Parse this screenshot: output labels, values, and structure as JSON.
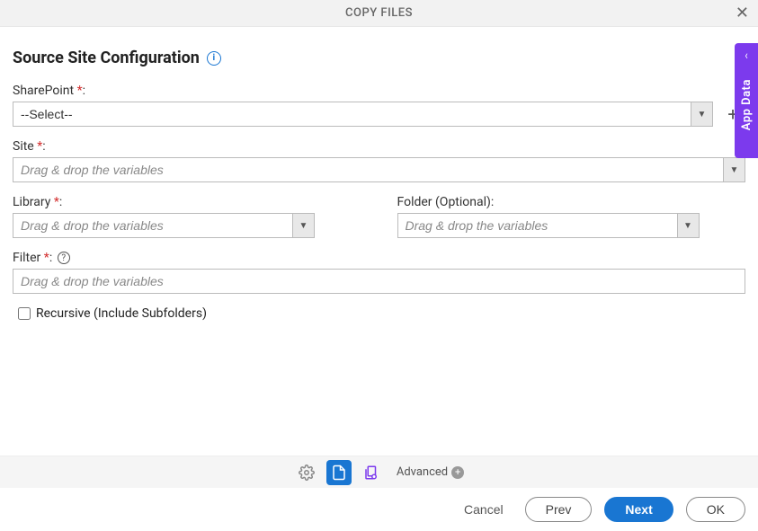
{
  "header": {
    "title": "COPY FILES"
  },
  "section": {
    "title": "Source Site Configuration"
  },
  "fields": {
    "sharepoint": {
      "label": "SharePoint",
      "required": "*",
      "placeholder": "--Select--"
    },
    "site": {
      "label": "Site",
      "required": "*",
      "placeholder": "Drag & drop the variables"
    },
    "library": {
      "label": "Library",
      "required": "*",
      "placeholder": "Drag & drop the variables"
    },
    "folder": {
      "label": "Folder (Optional):",
      "placeholder": "Drag & drop the variables"
    },
    "filter": {
      "label": "Filter",
      "required": "*",
      "placeholder": "Drag & drop the variables"
    },
    "recursive": {
      "label": "Recursive (Include Subfolders)"
    }
  },
  "bottombar": {
    "advanced": "Advanced"
  },
  "buttons": {
    "cancel": "Cancel",
    "prev": "Prev",
    "next": "Next",
    "ok": "OK"
  },
  "sidetab": {
    "label": "App Data"
  }
}
